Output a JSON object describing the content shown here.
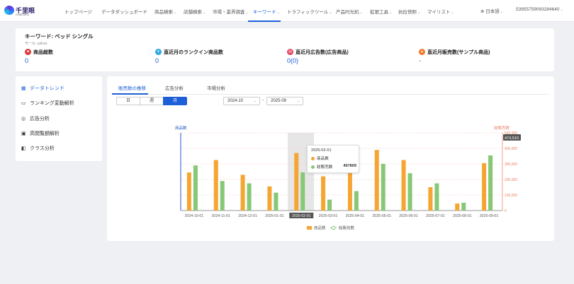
{
  "brand": {
    "name": "千里眼",
    "sub": "CHIBIGAKU"
  },
  "nav": {
    "items": [
      "トップページ",
      "データダッシュボード",
      "商品検索",
      "店舗検索",
      "市場・業界調査",
      "キーワード",
      "トラフィックツール",
      "产品时光机",
      "拡張工具",
      "抗拉快照",
      "マイリスト"
    ],
    "active": "キーワード",
    "lang": "日本語",
    "user": "5395575909328464​0"
  },
  "keyword": {
    "title": "キーワード: ベッド シングル",
    "model": "モール: yahoo"
  },
  "metrics": [
    {
      "label": "商品総数",
      "value": "0",
      "icon": "box-icon",
      "color": "#e03a3a"
    },
    {
      "label": "直近月のランクイン商品数",
      "value": "0",
      "icon": "rank-icon",
      "color": "#2fa9e6"
    },
    {
      "label": "直近月広告数(広告商品)",
      "value": "0(0)",
      "icon": "ad-icon",
      "color": "#e0475e"
    },
    {
      "label": "直近月販売数(サンプル商品)",
      "value": "-",
      "icon": "fire-icon",
      "color": "#f07a2a"
    }
  ],
  "sidebar": {
    "items": [
      {
        "label": "データトレンド",
        "icon": "trend-icon"
      },
      {
        "label": "ランキング変動解析",
        "icon": "ranking-icon"
      },
      {
        "label": "広告分析",
        "icon": "ad-analysis-icon"
      },
      {
        "label": "高閲覧額解析",
        "icon": "browse-icon"
      },
      {
        "label": "クラス分析",
        "icon": "class-icon"
      }
    ]
  },
  "tabs": [
    "販売数の推移",
    "広告分析",
    "市場分析"
  ],
  "period": {
    "options": [
      "日",
      "週",
      "月"
    ],
    "active": "月"
  },
  "range": {
    "from": "2024-10",
    "to": "2025-09",
    "sep": "-"
  },
  "tooltip": {
    "date": "2025-02-01",
    "s1": "商品数",
    "s2": "総販売数",
    "s2val": "467809"
  },
  "colors": {
    "bar1": "#f5a532",
    "bar2": "#86c876",
    "accent": "#1c5fd7"
  },
  "chart_data": {
    "type": "bar",
    "ylabel": "商品数",
    "y2label": "総販売数",
    "y2max_label": "474,510",
    "categories": [
      "2024-10-01",
      "2024-11-01",
      "2024-12-01",
      "2025-01-01",
      "2025-02-01",
      "2025-03-01",
      "2025-04-01",
      "2025-05-01",
      "2025-06-01",
      "2025-07-01",
      "2025-08-01",
      "2025-09-01"
    ],
    "y2ticks": [
      "500,000",
      "400,000",
      "300,000",
      "200,000",
      "100,000",
      "0"
    ],
    "y2max": 500000,
    "series": [
      {
        "name": "商品数",
        "values": [
          0.49,
          0.65,
          0.46,
          0.31,
          0.74,
          0.44,
          0.51,
          0.78,
          0.65,
          0.3,
          0.09,
          0.61
        ]
      },
      {
        "name": "総販売数",
        "values": [
          290000,
          190000,
          175000,
          115000,
          245000,
          70000,
          125000,
          300000,
          240000,
          175000,
          50000,
          355000
        ]
      }
    ],
    "highlight": "2025-02-01"
  }
}
